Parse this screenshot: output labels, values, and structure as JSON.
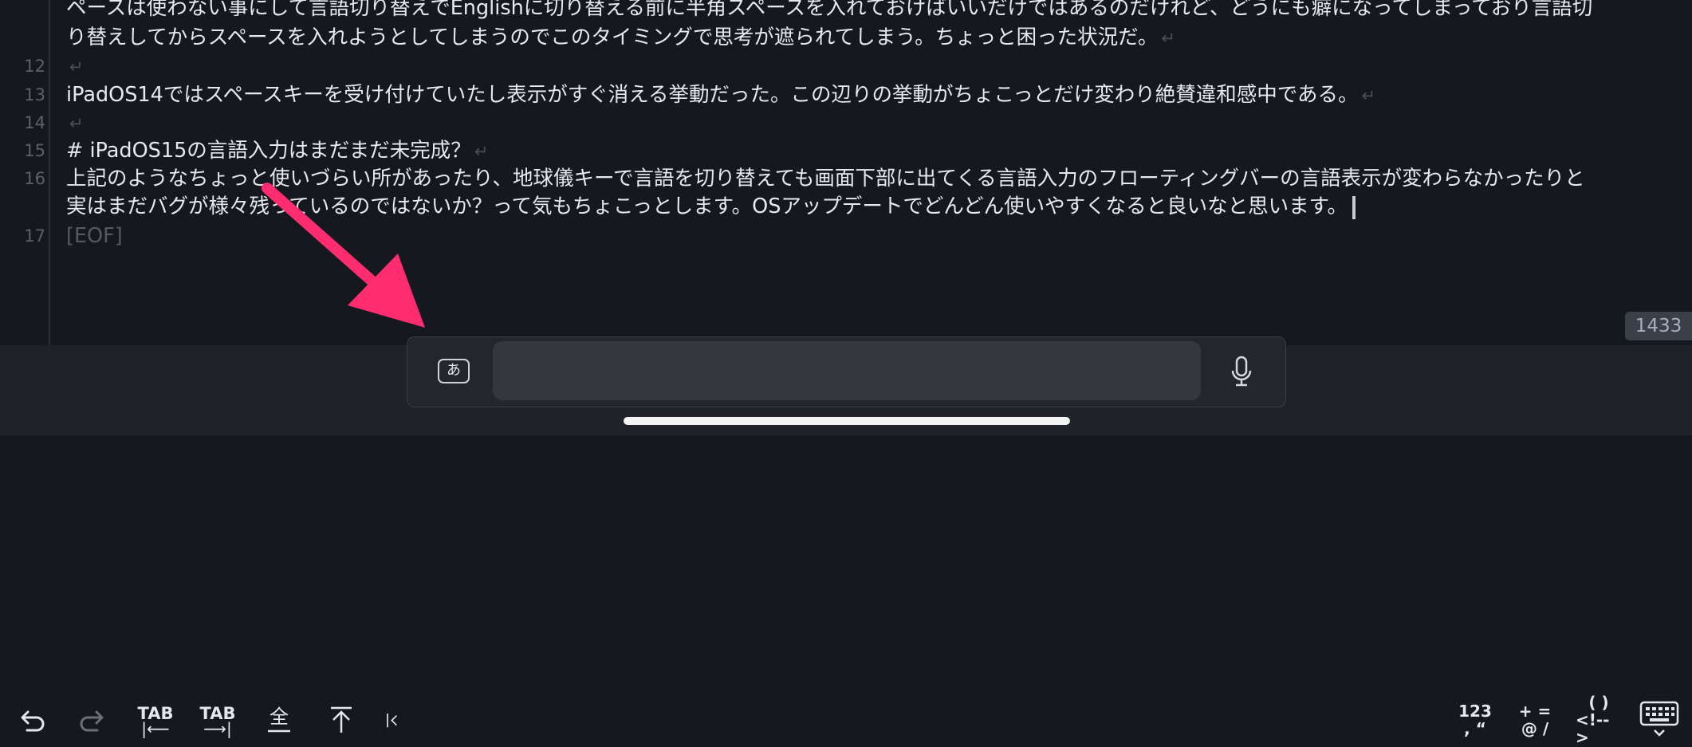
{
  "editor": {
    "lines": [
      {
        "num": "",
        "text": "ペースは使わない事にして言語切り替えでEnglishに切り替える前に半角スペースを入れておけばいいだけではあるのだけれど、どうにも癖になってしまっており言語切",
        "ret": ""
      },
      {
        "num": "",
        "text": "り替えしてからスペースを入れようとしてしまうのでこのタイミングで思考が遮られてしまう。ちょっと困った状況だ。",
        "ret": "↵"
      },
      {
        "num": "12",
        "text": "",
        "ret": "↵"
      },
      {
        "num": "13",
        "text": "iPadOS14ではスペースキーを受け付けていたし表示がすぐ消える挙動だった。この辺りの挙動がちょこっとだけ変わり絶賛違和感中である。",
        "ret": "↵"
      },
      {
        "num": "14",
        "text": "",
        "ret": "↵"
      },
      {
        "num": "15",
        "text": "# iPadOS15の言語入力はまだまだ未完成？",
        "ret": "↵"
      },
      {
        "num": "16",
        "text": "上記のようなちょっと使いづらい所があったり、地球儀キーで言語を切り替えても画面下部に出てくる言語入力のフローティングバーの言語表示が変わらなかったりと",
        "ret": ""
      },
      {
        "num": "",
        "text": "実はまだバグが様々残っているのではないか？って気もちょこっとします。OSアップデートでどんどん使いやすくなると良いなと思います。",
        "ret": "↵"
      },
      {
        "num": "17",
        "text": "[EOF]",
        "ret": ""
      }
    ],
    "char_count": "1433"
  },
  "toolbar": {
    "tab_label_1": "TAB",
    "tab_label_2": "TAB",
    "sym1_top": "123",
    "sym1_bottom": ", “",
    "sym2_top": "+ =",
    "sym2_bottom": "@ /",
    "sym3_top": "(   )",
    "sym3_bottom": "<!-->"
  },
  "floating_bar": {
    "language_label": "あ"
  },
  "colors": {
    "annotation_arrow": "#ff2d6f",
    "background": "#15181e"
  }
}
